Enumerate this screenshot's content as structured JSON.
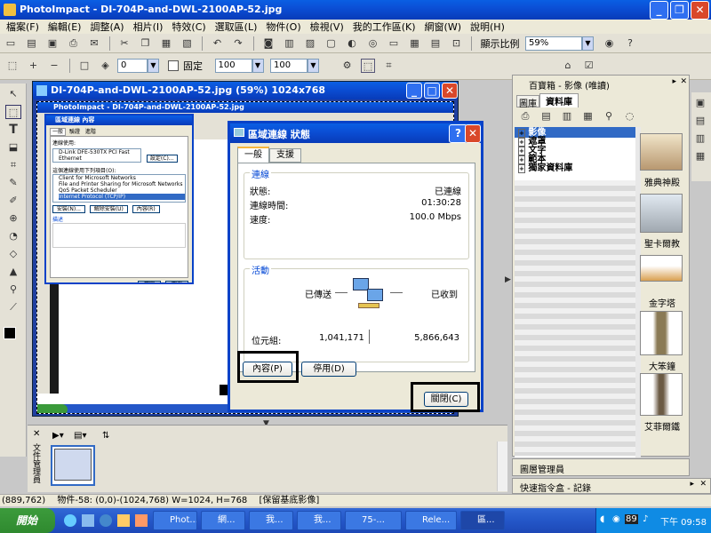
{
  "app": {
    "title": "PhotoImpact - DI-704P-and-DWL-2100AP-52.jpg"
  },
  "menu": [
    "檔案(F)",
    "編輯(E)",
    "調整(A)",
    "相片(I)",
    "特效(C)",
    "選取區(L)",
    "物件(O)",
    "檢視(V)",
    "我的工作區(K)",
    "網窗(W)",
    "說明(H)"
  ],
  "toolbar1": {
    "zoom_label": "顯示比例",
    "zoom_value": "59%"
  },
  "toolbar2": {
    "val1": "0",
    "fixed_label": "固定",
    "width": "100",
    "height": "100"
  },
  "document": {
    "title": "DI-704P-and-DWL-2100AP-52.jpg (59%) 1024x768",
    "inner_title": "PhotoImpact - DI-704P-and-DWL-2100AP-52.jpg"
  },
  "lan_dialog": {
    "title": "區域連線 狀態",
    "tabs": [
      "一般",
      "支援"
    ],
    "connection_group": "連線",
    "status_label": "狀態:",
    "status_value": "已連線",
    "duration_label": "連線時間:",
    "duration_value": "01:30:28",
    "speed_label": "速度:",
    "speed_value": "100.0 Mbps",
    "activity_group": "活動",
    "sent_label": "已傳送",
    "received_label": "已收到",
    "bytes_label": "位元組:",
    "bytes_sent": "1,041,171",
    "bytes_received": "5,866,643",
    "properties_button": "內容(P)",
    "disable_button": "停用(D)",
    "close_button": "關閉(C)"
  },
  "inner_dialog": {
    "title": "區域連線 內容",
    "tabs": [
      "一般",
      "驗證",
      "進階"
    ],
    "connect_using_label": "連線使用:",
    "adapter": "D-Link DFE-530TX PCI Fast Ethernet",
    "configure_button": "設定(C)...",
    "items_label": "這個連線使用下列項目(O):",
    "items": [
      "Client for Microsoft Networks",
      "File and Printer Sharing for Microsoft Networks",
      "QoS Packet Scheduler",
      "Internet Protocol (TCP/IP)"
    ],
    "install_button": "安裝(N)...",
    "uninstall_button": "解除安裝(U)",
    "properties_button": "內容(R)",
    "desc_label": "描述",
    "ok_button": "確定",
    "cancel_button": "取消"
  },
  "right_panel": {
    "title": "百寶箱 - 影像 (唯讀)",
    "tabs": [
      "圖庫",
      "資料庫"
    ],
    "tree": [
      "影像",
      "遮罩",
      "文字",
      "範本",
      "獨家資料庫"
    ],
    "thumbs": [
      "雅典神殿",
      "聖卡爾教",
      "金字塔",
      "大笨鐘",
      "艾菲爾鐵"
    ],
    "layers_panel": "圖層管理員",
    "history_panel": "快速指令盒 - 記錄"
  },
  "bottom_panel": {
    "label": "文件管理員"
  },
  "statusbar": {
    "coords": "(889,762)",
    "object": "物件-58: (0,0)-(1024,768) W=1024, H=768",
    "hint": "[保留基底影像]"
  },
  "taskbar": {
    "start": "開始",
    "items": [
      "Phot...",
      "網...",
      "我...",
      "我...",
      "75-...",
      "Rele...",
      "區..."
    ],
    "tray_num": "89",
    "clock": "下午 09:58"
  }
}
